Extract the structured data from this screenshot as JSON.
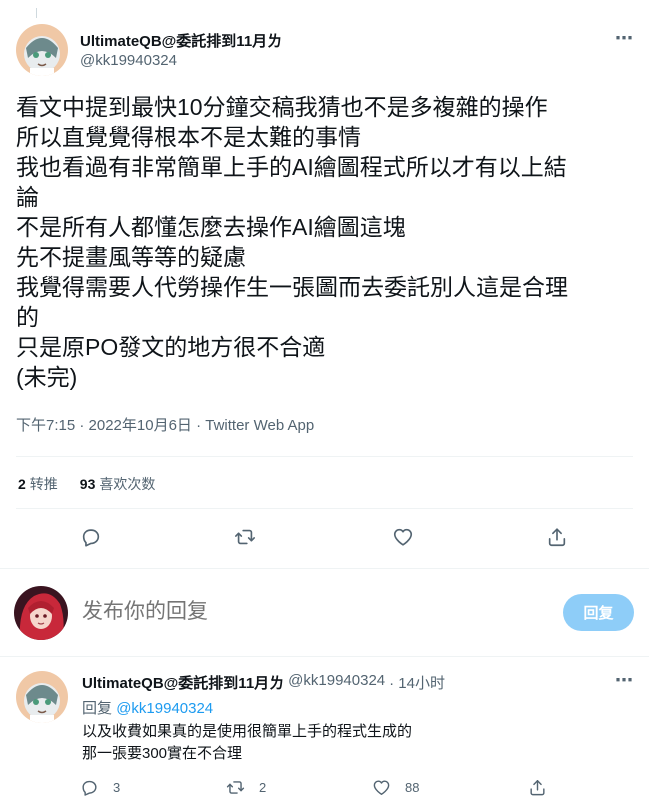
{
  "main_tweet": {
    "author_name": "UltimateQB@委託排到11月ㄌ",
    "author_handle": "@kk19940324",
    "text": "看文中提到最快10分鐘交稿我猜也不是多複雜的操作\n所以直覺覺得根本不是太難的事情\n我也看過有非常簡單上手的AI繪圖程式所以才有以上結\n論\n不是所有人都懂怎麼去操作AI繪圖這塊\n先不提畫風等等的疑慮\n我覺得需要人代勞操作生一張圖而去委託別人這是合理\n的\n只是原PO發文的地方很不合適\n(未完)",
    "timestamp": "下午7:15 · 2022年10月6日 · Twitter Web App",
    "retweet_count": "2",
    "retweet_label": "转推",
    "like_count": "93",
    "like_label": "喜欢次数",
    "more_icon": "⋯"
  },
  "reply_composer": {
    "placeholder": "发布你的回复",
    "button_label": "回复"
  },
  "reply_tweet": {
    "author_name": "UltimateQB@委託排到11月ㄌ",
    "author_handle": "@kk19940324",
    "time_ago": "· 14小时",
    "replying_label": "回复",
    "replying_handle": "@kk19940324",
    "text": "以及收費如果真的是使用很簡單上手的程式生成的\n那一張要300實在不合理",
    "reply_count": "3",
    "retweet_count": "2",
    "like_count": "88",
    "more_icon": "⋯"
  },
  "colors": {
    "accent": "#1d9bf0",
    "reply_button_disabled": "#8ecdf8",
    "secondary_text": "#536471"
  },
  "icons": [
    "reply-icon",
    "retweet-icon",
    "like-icon",
    "share-icon",
    "more-icon"
  ]
}
